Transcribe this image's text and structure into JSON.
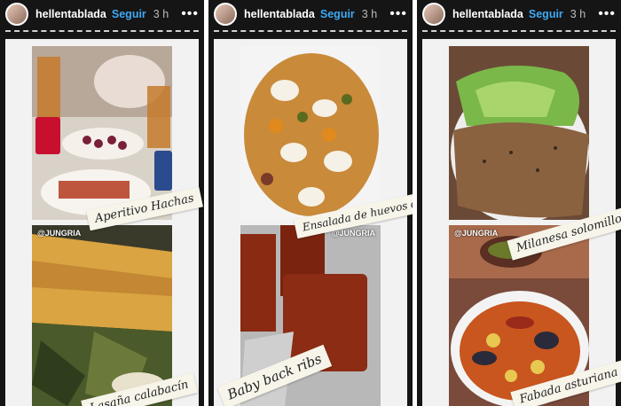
{
  "stories": [
    {
      "username": "hellentablada",
      "follow_label": "Seguir",
      "time": "3 h",
      "more_label": "•••",
      "credit_bottom": "@JUNGRIA",
      "label_top": "Aperitivo Hachas",
      "label_bottom": "Lasaña calabacín"
    },
    {
      "username": "hellentablada",
      "follow_label": "Seguir",
      "time": "3 h",
      "more_label": "•••",
      "credit_bottom": "@JUNGRIA",
      "label_top": "Ensalada de huevos de bacalao",
      "label_bottom": "Baby back ribs"
    },
    {
      "username": "hellentablada",
      "follow_label": "Seguir",
      "time": "3 h",
      "more_label": "•••",
      "credit_bottom": "@JUNGRIA",
      "label_top": "Milanesa solomillo",
      "label_bottom": "Fabada asturiana"
    }
  ],
  "colors": {
    "accent": "#3fa9f5",
    "header_bg": "#151515",
    "card_bg": "#f2f2f2"
  }
}
